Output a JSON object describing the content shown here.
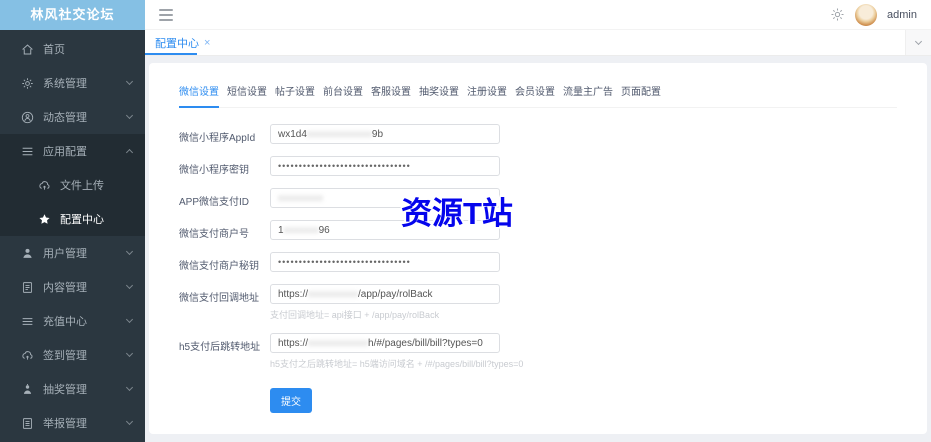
{
  "colors": {
    "primary": "#2d8cf0",
    "logo_bg": "#85c0e4",
    "sidebar_bg": "#2b3740",
    "sidebar_expanded_bg": "#222c33",
    "watermark_blue": "#0505ec"
  },
  "sidebar": {
    "title": "林风社交论坛",
    "items": [
      {
        "label": "首页",
        "icon": "home-icon"
      },
      {
        "label": "系统管理",
        "icon": "gear-icon",
        "chevron": "down"
      },
      {
        "label": "动态管理",
        "icon": "person-circle-icon",
        "chevron": "down"
      },
      {
        "label": "应用配置",
        "icon": "menu-icon",
        "chevron": "up",
        "expanded": true
      },
      {
        "label": "文件上传",
        "icon": "cloud-upload-icon",
        "sub": true
      },
      {
        "label": "配置中心",
        "icon": "star-icon",
        "sub": true,
        "active": true
      },
      {
        "label": "用户管理",
        "icon": "user-icon",
        "chevron": "down"
      },
      {
        "label": "内容管理",
        "icon": "document-icon",
        "chevron": "down"
      },
      {
        "label": "充值中心",
        "icon": "list-icon",
        "chevron": "down"
      },
      {
        "label": "签到管理",
        "icon": "cloud-upload-icon",
        "chevron": "down"
      },
      {
        "label": "抽奖管理",
        "icon": "lottery-person-icon",
        "chevron": "down"
      },
      {
        "label": "举报管理",
        "icon": "report-document-icon",
        "chevron": "down"
      }
    ]
  },
  "topbar": {
    "username": "admin"
  },
  "tagbar": {
    "tag": "配置中心",
    "close": "×"
  },
  "tabs": [
    "微信设置",
    "短信设置",
    "帖子设置",
    "前台设置",
    "客服设置",
    "抽奖设置",
    "注册设置",
    "会员设置",
    "流量主广告",
    "页面配置"
  ],
  "form": {
    "fields": [
      {
        "label": "微信小程序AppId",
        "prefix": "wx1d4",
        "redacted": "xxxxxxxxxxxxx",
        "suffix": "9b"
      },
      {
        "label": "微信小程序密钥",
        "dots": "••••••••••••••••••••••••••••••••"
      },
      {
        "label": "APP微信支付ID",
        "prefix": "",
        "redacted": "xxxxxxxxx",
        "suffix": ""
      },
      {
        "label": "微信支付商户号",
        "prefix": "1",
        "redacted": "xxxxxxx",
        "suffix": "96"
      },
      {
        "label": "微信支付商户秘钥",
        "dots": "••••••••••••••••••••••••••••••••"
      },
      {
        "label": "微信支付回调地址",
        "prefix": "https://",
        "redacted": "xxxxxxxxxx",
        "suffix": "/app/pay/rolBack",
        "helper": "支付回调地址= api接口 + /app/pay/rolBack"
      },
      {
        "label": "h5支付后跳转地址",
        "prefix": "https://",
        "redacted": "xxxxxxxxxxxx",
        "suffix": "h/#/pages/bill/bill?types=0",
        "helper": "h5支付之后跳转地址= h5端访问域名 + /#/pages/bill/bill?types=0"
      }
    ],
    "submit": "提交"
  },
  "watermark": "资源T站"
}
